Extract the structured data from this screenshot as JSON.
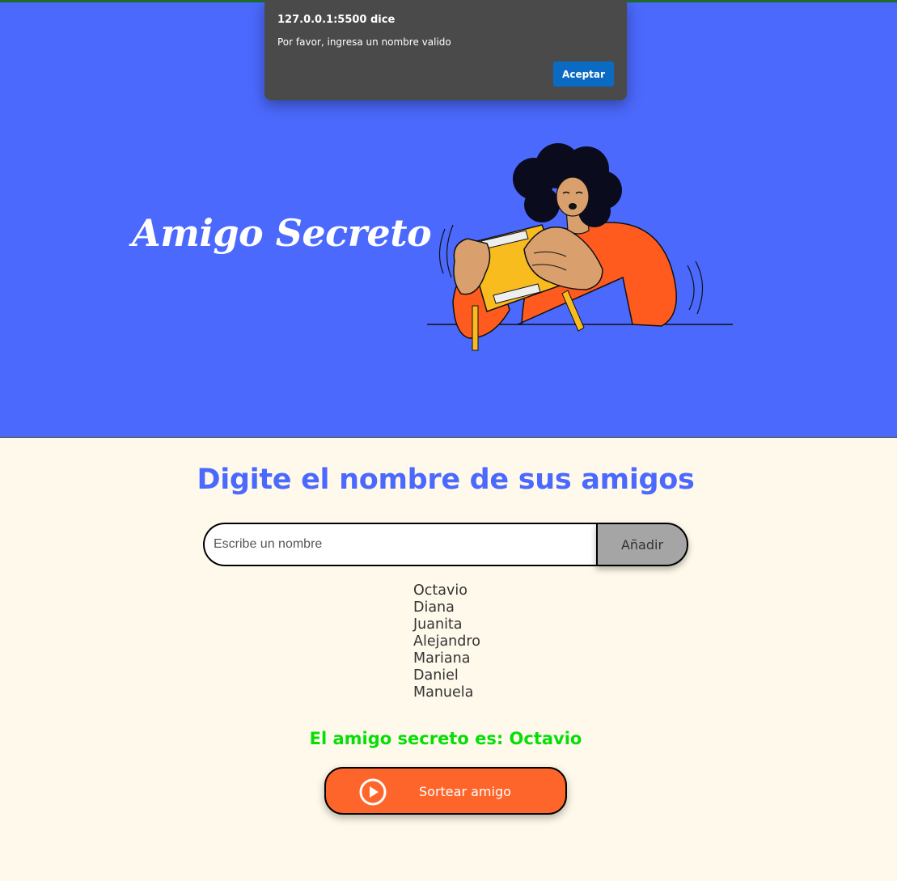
{
  "alert": {
    "origin": "127.0.0.1:5500 dice",
    "message": "Por favor, ingresa un nombre valido",
    "accept_label": "Aceptar"
  },
  "hero": {
    "title": "Amigo Secreto",
    "illustration": "person-opening-gift-box"
  },
  "main": {
    "heading": "Digite el nombre de sus amigos",
    "input": {
      "placeholder": "Escribe un nombre",
      "value": ""
    },
    "add_label": "Añadir",
    "friends": [
      "Octavio",
      "Diana",
      "Juanita",
      "Alejandro",
      "Mariana",
      "Daniel",
      "Manuela"
    ],
    "result": "El amigo secreto es: Octavio",
    "draw_label": "Sortear amigo",
    "draw_icon": "play-circle-icon"
  },
  "colors": {
    "hero_bg": "#4B69FD",
    "page_bg": "#FFF9EB",
    "heading": "#4B69FD",
    "result": "#05DF05",
    "draw_button": "#FE652B",
    "add_button": "#A5A5A5",
    "alert_bg": "#4A4A4A",
    "alert_button": "#0B6BC2"
  }
}
